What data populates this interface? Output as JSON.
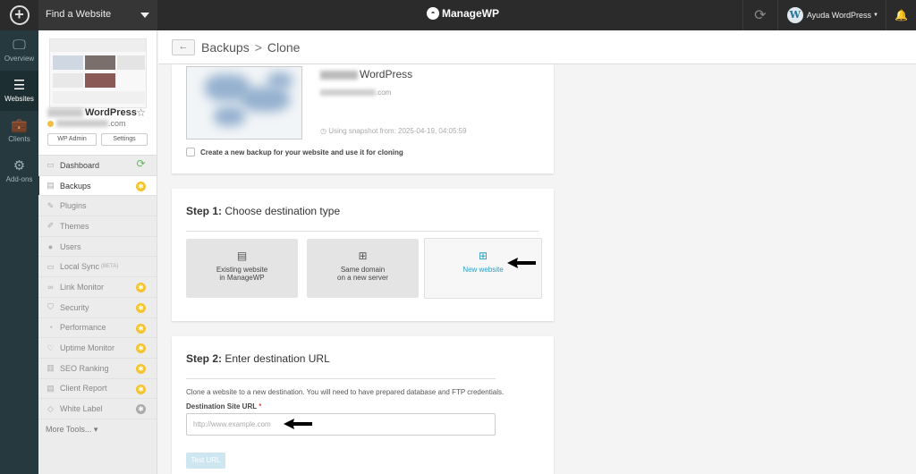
{
  "topbar": {
    "site_select": "Find a Website",
    "brand": "ManageWP",
    "user_name": "Ayuda WordPress"
  },
  "rail": {
    "items": [
      {
        "label": "Overview"
      },
      {
        "label": "Websites"
      },
      {
        "label": "Clients"
      },
      {
        "label": "Add-ons"
      }
    ]
  },
  "sidebar": {
    "site_name": "WordPress",
    "site_domain": ".com",
    "wp_admin": "WP Admin",
    "settings": "Settings",
    "menu": [
      {
        "label": "Dashboard"
      },
      {
        "label": "Backups"
      },
      {
        "label": "Plugins"
      },
      {
        "label": "Themes"
      },
      {
        "label": "Users"
      },
      {
        "label": "Local Sync",
        "tag": "BETA"
      },
      {
        "label": "Link Monitor"
      },
      {
        "label": "Security"
      },
      {
        "label": "Performance"
      },
      {
        "label": "Uptime Monitor"
      },
      {
        "label": "SEO Ranking"
      },
      {
        "label": "Client Report"
      },
      {
        "label": "White Label"
      }
    ],
    "more_tools": "More Tools..."
  },
  "header": {
    "crumb_parent": "Backups",
    "crumb_sep": ">",
    "crumb_current": "Clone"
  },
  "snapshot": {
    "site_name": "WordPress",
    "domain": ".com",
    "date": "Using snapshot from: 2025-04-19, 04:05:59",
    "checkbox_label": "Create a new backup for your website and use it for cloning"
  },
  "step1": {
    "num": "Step 1:",
    "title": "Choose destination type",
    "options": [
      {
        "line1": "Existing website",
        "line2": "in ManageWP"
      },
      {
        "line1": "Same domain",
        "line2": "on a new server"
      },
      {
        "line1": "New website"
      }
    ]
  },
  "step2": {
    "num": "Step 2:",
    "title": "Enter destination URL",
    "help": "Clone a website to a new destination. You will need to have prepared database and FTP credentials.",
    "field_label": "Destination Site URL",
    "required": "*",
    "placeholder": "http://www.example.com",
    "test_button": "Test URL"
  },
  "colors": {
    "rail_bg": "#26393f",
    "topbar_bg": "#2b2b2b",
    "accent": "#2a9dc4",
    "badge": "#f4c430"
  }
}
